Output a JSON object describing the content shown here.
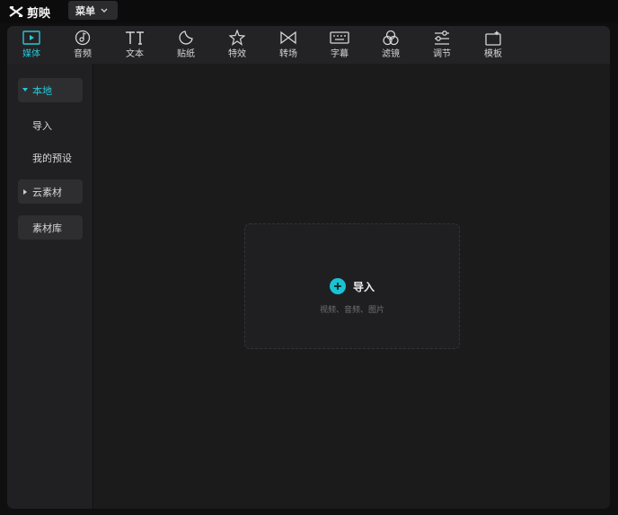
{
  "app": {
    "name": "剪映"
  },
  "menu": {
    "label": "菜单"
  },
  "toolbar": {
    "tabs": [
      {
        "id": "media",
        "label": "媒体",
        "icon": "media-icon"
      },
      {
        "id": "audio",
        "label": "音频",
        "icon": "audio-icon"
      },
      {
        "id": "text",
        "label": "文本",
        "icon": "text-icon"
      },
      {
        "id": "sticker",
        "label": "贴纸",
        "icon": "sticker-icon"
      },
      {
        "id": "effects",
        "label": "特效",
        "icon": "effects-icon"
      },
      {
        "id": "transition",
        "label": "转场",
        "icon": "transition-icon"
      },
      {
        "id": "subtitle",
        "label": "字幕",
        "icon": "keyboard-icon"
      },
      {
        "id": "filter",
        "label": "滤镜",
        "icon": "filter-icon"
      },
      {
        "id": "adjust",
        "label": "调节",
        "icon": "adjust-icon"
      },
      {
        "id": "template",
        "label": "模板",
        "icon": "template-icon"
      }
    ],
    "active": "media"
  },
  "sidebar": {
    "items": [
      {
        "label": "本地"
      },
      {
        "label": "导入"
      },
      {
        "label": "我的预设"
      },
      {
        "label": "云素材"
      },
      {
        "label": "素材库"
      }
    ]
  },
  "import": {
    "label": "导入",
    "hint": "视频、音频、图片"
  },
  "colors": {
    "accent": "#28c8d8",
    "plus_button": "#19c3d2"
  }
}
